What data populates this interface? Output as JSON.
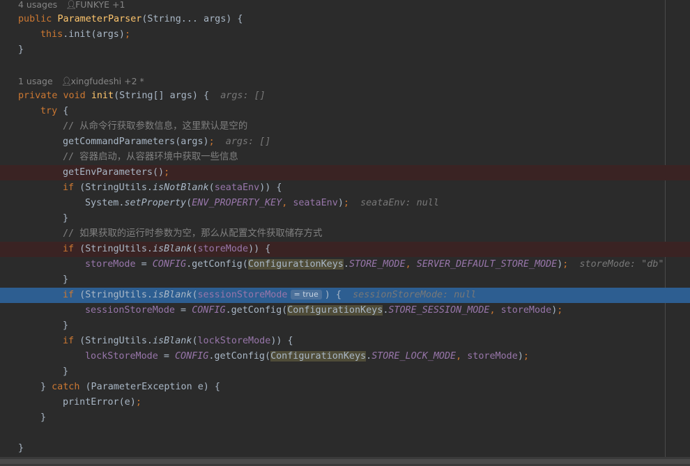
{
  "editor": {
    "usage_method1": "4 usages",
    "author_method1": "FUNKYE +1",
    "usage_method2": "1 usage",
    "author_method2": "xingfudeshi +2 *",
    "person_icon": "person-icon",
    "code": {
      "kw_public": "public",
      "ctor_name": "ParameterParser",
      "ctor_params": "(String... args) {",
      "kw_this": "this",
      "this_init": ".init(args)",
      "semi": ";",
      "close_brace": "}",
      "kw_private": "private",
      "kw_void": "void",
      "method_init": "init",
      "init_params": "(String[] args) {",
      "hint_args": "args: []",
      "kw_try": "try",
      "open_brace": " {",
      "comment1": "// 从命令行获取参数信息，这里默认是空的",
      "call_getCommand": "getCommandParameters(args)",
      "comment2": "// 容器启动，从容器环境中获取一些信息",
      "call_getEnv": "getEnvParameters()",
      "kw_if": "if",
      "paren_su": " (StringUtils.",
      "m_isNotBlank": "isNotBlank",
      "m_isBlank": "isBlank",
      "open_paren": "(",
      "f_seataEnv": "seataEnv",
      "close_paren_brace": ")) {",
      "system_prefix": "System.",
      "m_setProperty": "setProperty",
      "c_env_key": "ENV_PROPERTY_KEY",
      "comma_space": ", ",
      "close_paren_semi": ")",
      "hint_seataEnv": "seataEnv: null",
      "comment3": "// 如果获取的运行时参数为空，那么从配置文件获取储存方式",
      "f_storeMode": "storeMode",
      "assign": " = ",
      "c_config": "CONFIG",
      "get_config": ".getConfig(",
      "cls_configkeys": "ConfigurationKeys",
      "dot": ".",
      "c_store_mode": "STORE_MODE",
      "c_server_default": "SERVER_DEFAULT_STORE_MODE",
      "hint_storeMode": "storeMode: \"db\"",
      "f_sessionStoreMode": "sessionStoreMode",
      "inline_value": "= true",
      "close_paren_brace_single": ") {",
      "hint_sessionStoreMode": "sessionStoreMode: null",
      "c_store_session_mode": "STORE_SESSION_MODE",
      "f_lockStoreMode": "lockStoreMode",
      "c_store_lock_mode": "STORE_LOCK_MODE",
      "close_brace_space": "} ",
      "kw_catch": "catch",
      "catch_params": " (ParameterException e) {",
      "call_printError": "printError(e)"
    }
  }
}
